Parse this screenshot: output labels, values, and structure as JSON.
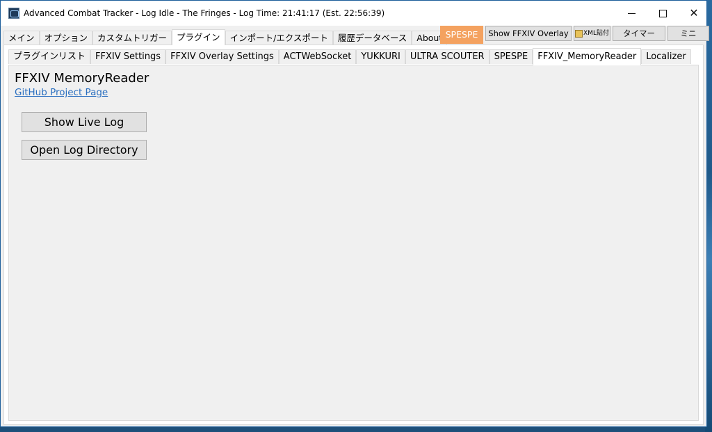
{
  "window": {
    "title": "Advanced Combat Tracker - Log Idle - The Fringes - Log Time: 21:41:17 (Est. 22:56:39)",
    "controls": {
      "minimize": "─",
      "maximize": "☐",
      "close": "✕"
    }
  },
  "main_tabs": [
    {
      "label": "メイン",
      "active": false
    },
    {
      "label": "オプション",
      "active": false
    },
    {
      "label": "カスタムトリガー",
      "active": false
    },
    {
      "label": "プラグイン",
      "active": true
    },
    {
      "label": "インポート/エクスポート",
      "active": false
    },
    {
      "label": "履歴データベース",
      "active": false
    },
    {
      "label": "About",
      "active": false
    }
  ],
  "top_buttons": {
    "spespe": "SPESPE",
    "overlay": "Show FFXIV Overlay",
    "xml": "XML貼付",
    "timer": "タイマー",
    "mini": "ミニ"
  },
  "sub_tabs": [
    {
      "label": "プラグインリスト",
      "active": false
    },
    {
      "label": "FFXIV Settings",
      "active": false
    },
    {
      "label": "FFXIV Overlay Settings",
      "active": false
    },
    {
      "label": "ACTWebSocket",
      "active": false
    },
    {
      "label": "YUKKURI",
      "active": false
    },
    {
      "label": "ULTRA SCOUTER",
      "active": false
    },
    {
      "label": "SPESPE",
      "active": false
    },
    {
      "label": "FFXIV_MemoryReader",
      "active": true
    },
    {
      "label": "Localizer",
      "active": false
    }
  ],
  "plugin": {
    "title": "FFXIV MemoryReader",
    "link": "GitHub Project Page",
    "show_live_log": "Show Live Log",
    "open_log_directory": "Open Log Directory"
  },
  "colors": {
    "accent_spespe": "#f4a260",
    "link": "#2a6fc0"
  }
}
